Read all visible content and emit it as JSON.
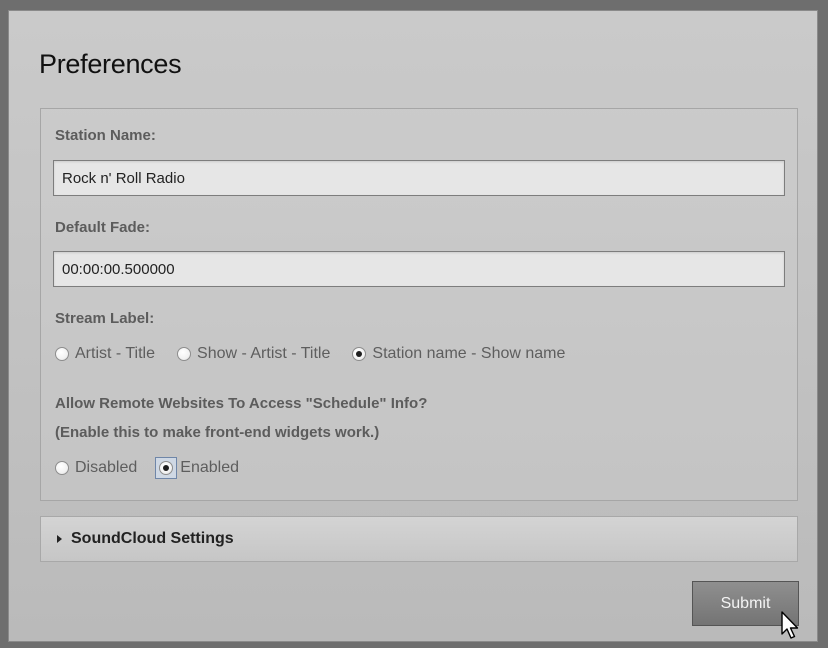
{
  "dialog": {
    "title": "Preferences"
  },
  "form": {
    "station_name": {
      "label": "Station Name:",
      "value": "Rock n' Roll Radio"
    },
    "default_fade": {
      "label": "Default Fade:",
      "value": "00:00:00.500000"
    },
    "stream_label": {
      "label": "Stream Label:",
      "options": [
        {
          "label": "Artist - Title",
          "checked": false
        },
        {
          "label": "Show - Artist - Title",
          "checked": false
        },
        {
          "label": "Station name - Show name",
          "checked": true
        }
      ]
    },
    "remote_access": {
      "label_line1": "Allow Remote Websites To Access \"Schedule\" Info?",
      "label_line2": "(Enable this to make front-end widgets work.)",
      "options": [
        {
          "label": "Disabled",
          "checked": false
        },
        {
          "label": "Enabled",
          "checked": true
        }
      ]
    }
  },
  "soundcloud": {
    "label": "SoundCloud Settings",
    "expanded": false,
    "icon": "triangle-right-icon"
  },
  "submit": {
    "label": "Submit"
  },
  "cursor": {
    "icon": "mouse-pointer-icon"
  }
}
